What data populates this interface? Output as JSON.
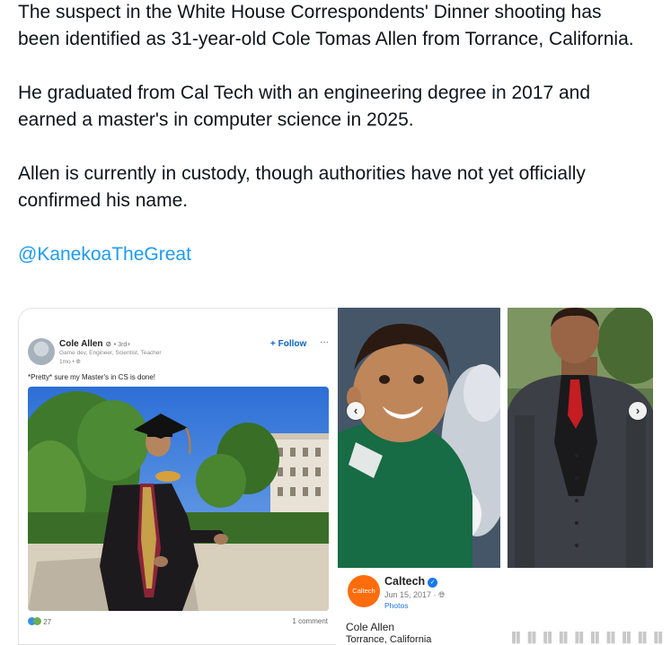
{
  "tweet": {
    "paragraphs": [
      "The suspect in the White House Correspondents' Dinner shooting has been identified as 31-year-old Cole Tomas Allen from Torrance, California.",
      "He graduated from Cal Tech with an engineering degree in 2017 and earned a master's in computer science in 2025.",
      "Allen is currently in custody, though authorities have not yet officially confirmed his name."
    ],
    "mention": "@KanekoaTheGreat"
  },
  "linkedin_post": {
    "author_name": "Cole Allen",
    "degree": "• 3rd+",
    "headline": "Game dev, Engineer, Scientist, Teacher",
    "time": "1mo •",
    "follow_label": "+ Follow",
    "more_label": "···",
    "caption": "*Pretty* sure my Master's in CS is done!",
    "reactions_count": "27",
    "comments_label": "1 comment",
    "photo_alt": "graduate in cap and gown seated outdoors"
  },
  "facebook_post": {
    "logo_text": "Caltech",
    "page_name": "Caltech",
    "date": "Jun 15, 2017 ·",
    "photos_label": "Photos",
    "person_name": "Cole Allen",
    "location": "Torrance, California"
  },
  "carousel": {
    "prev_icon": "‹",
    "next_icon": "›"
  },
  "colors": {
    "mention": "#1d9bf0",
    "linkedin_blue": "#0a66c2",
    "caltech_orange": "#ff6c0c",
    "facebook_blue": "#1877f2"
  }
}
